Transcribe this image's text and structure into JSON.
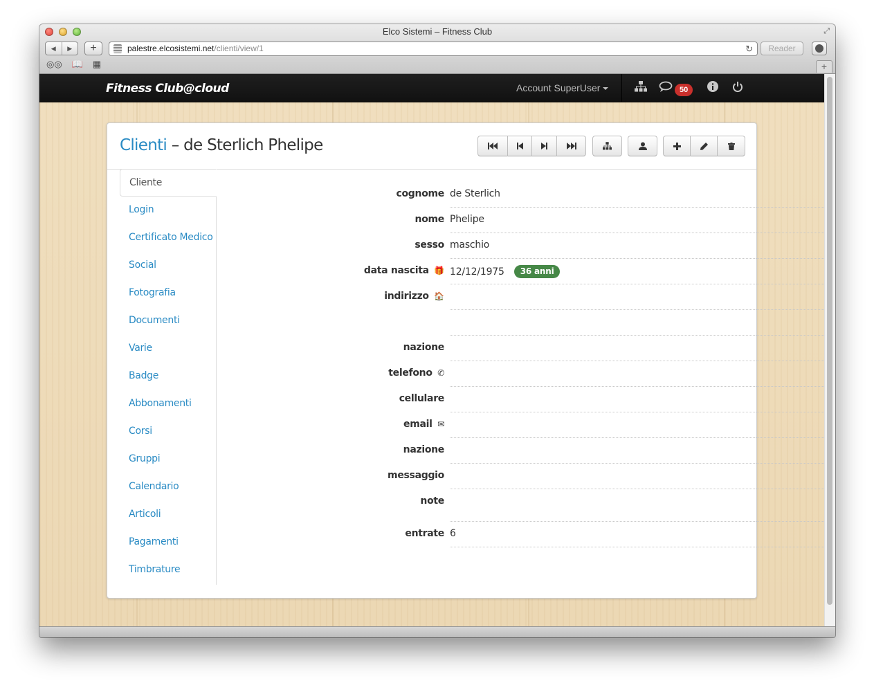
{
  "window": {
    "title": "Elco Sistemi – Fitness Club",
    "url_host": "palestre.elcosistemi.net",
    "url_path": "/clienti/view/1",
    "reader_label": "Reader"
  },
  "navbar": {
    "brand": "Fitness Club@cloud",
    "account_label": "Account SuperUser",
    "messages_count": "50"
  },
  "header": {
    "breadcrumb": "Clienti",
    "separator": " – ",
    "title": "de Sterlich Phelipe"
  },
  "toolbar": {
    "icons": [
      "first-record-icon",
      "previous-record-icon",
      "next-record-icon",
      "last-record-icon",
      "hierarchy-icon",
      "user-icon",
      "plus-icon",
      "pencil-icon",
      "trash-icon"
    ]
  },
  "sidebar": {
    "items": [
      {
        "label": "Cliente",
        "active": true
      },
      {
        "label": "Login"
      },
      {
        "label": "Certificato Medico"
      },
      {
        "label": "Social"
      },
      {
        "label": "Fotografia"
      },
      {
        "label": "Documenti"
      },
      {
        "label": "Varie"
      },
      {
        "label": "Badge"
      },
      {
        "label": "Abbonamenti"
      },
      {
        "label": "Corsi"
      },
      {
        "label": "Gruppi"
      },
      {
        "label": "Calendario"
      },
      {
        "label": "Articoli"
      },
      {
        "label": "Pagamenti"
      },
      {
        "label": "Timbrature"
      }
    ]
  },
  "fields": {
    "cognome": {
      "label": "cognome",
      "value": "de Sterlich"
    },
    "nome": {
      "label": "nome",
      "value": "Phelipe"
    },
    "sesso": {
      "label": "sesso",
      "value": "maschio"
    },
    "data_nascita": {
      "label": "data nascita",
      "value": "12/12/1975",
      "age_badge": "36 anni"
    },
    "indirizzo": {
      "label": "indirizzo",
      "value": ""
    },
    "nazione": {
      "label": "nazione",
      "value": ""
    },
    "telefono": {
      "label": "telefono",
      "value": ""
    },
    "cellulare": {
      "label": "cellulare",
      "value": ""
    },
    "email": {
      "label": "email",
      "value": ""
    },
    "nazione2": {
      "label": "nazione",
      "value": ""
    },
    "messaggio": {
      "label": "messaggio",
      "value": ""
    },
    "note": {
      "label": "note",
      "value": ""
    },
    "entrate": {
      "label": "entrate",
      "value": "6"
    }
  },
  "colors": {
    "link": "#2a8bc4",
    "badge_green": "#468847",
    "badge_red": "#c9302c",
    "navbar": "#1a1a1a"
  }
}
